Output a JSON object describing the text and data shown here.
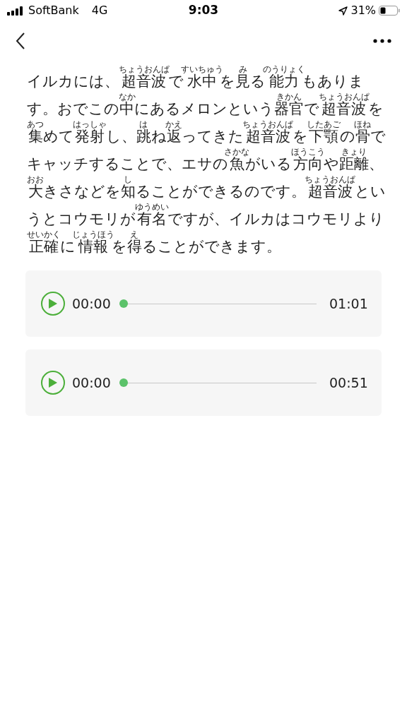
{
  "status_bar": {
    "carrier": "SoftBank",
    "network": "4G",
    "time": "9:03",
    "battery": "31%"
  },
  "article": {
    "segments": [
      {
        "text": "イルカには、"
      },
      {
        "text": "超音波",
        "ruby": "ちょうおんぱ"
      },
      {
        "text": "で"
      },
      {
        "text": "水中",
        "ruby": "すいちゅう"
      },
      {
        "text": "を"
      },
      {
        "text": "見",
        "ruby": "み"
      },
      {
        "text": "る"
      },
      {
        "text": "能力",
        "ruby": "のうりょく"
      },
      {
        "text": "もあります。おでこの"
      },
      {
        "text": "中",
        "ruby": "なか"
      },
      {
        "text": "にあるメロンという"
      },
      {
        "text": "器官",
        "ruby": "きかん"
      },
      {
        "text": "で"
      },
      {
        "text": "超音波",
        "ruby": "ちょうおんぱ"
      },
      {
        "text": "を"
      },
      {
        "text": "集",
        "ruby": "あつ"
      },
      {
        "text": "めて"
      },
      {
        "text": "発射",
        "ruby": "はっしゃ"
      },
      {
        "text": "し、"
      },
      {
        "text": "跳",
        "ruby": "は"
      },
      {
        "text": "ね"
      },
      {
        "text": "返",
        "ruby": "かえ"
      },
      {
        "text": "ってきた"
      },
      {
        "text": "超音波",
        "ruby": "ちょうおんぱ"
      },
      {
        "text": "を"
      },
      {
        "text": "下顎",
        "ruby": "したあご"
      },
      {
        "text": "の"
      },
      {
        "text": "骨",
        "ruby": "ほね"
      },
      {
        "text": "でキャッチすることで、エサの"
      },
      {
        "text": "魚",
        "ruby": "さかな"
      },
      {
        "text": "がいる"
      },
      {
        "text": "方向",
        "ruby": "ほうこう"
      },
      {
        "text": "や"
      },
      {
        "text": "距離",
        "ruby": "きょり"
      },
      {
        "text": "、"
      },
      {
        "text": "大",
        "ruby": "おお"
      },
      {
        "text": "きさなどを"
      },
      {
        "text": "知",
        "ruby": "し"
      },
      {
        "text": "ることができるのです。"
      },
      {
        "text": "超音波",
        "ruby": "ちょうおんぱ"
      },
      {
        "text": "というとコウモリが"
      },
      {
        "text": "有名",
        "ruby": "ゆうめい"
      },
      {
        "text": "ですが、イルカはコウモリより"
      },
      {
        "text": "正確",
        "ruby": "せいかく"
      },
      {
        "text": "に"
      },
      {
        "text": "情報",
        "ruby": "じょうほう"
      },
      {
        "text": "を"
      },
      {
        "text": "得",
        "ruby": "え"
      },
      {
        "text": "ることができます。"
      }
    ]
  },
  "audio_players": [
    {
      "current": "00:00",
      "duration": "01:01",
      "level": 0
    },
    {
      "current": "00:00",
      "duration": "00:51",
      "level": 0
    }
  ]
}
